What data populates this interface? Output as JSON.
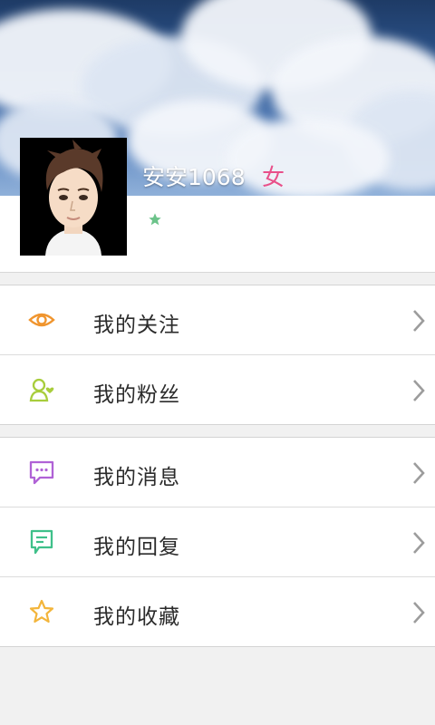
{
  "profile": {
    "username": "安安1068",
    "gender": "女"
  },
  "menu_groups": [
    {
      "items": [
        {
          "label": "我的关注",
          "icon": "eye-icon",
          "color": "#f0952e"
        },
        {
          "label": "我的粉丝",
          "icon": "user-heart-icon",
          "color": "#a8cd3c"
        }
      ]
    },
    {
      "items": [
        {
          "label": "我的消息",
          "icon": "chat-bubble-icon",
          "color": "#b062d6"
        },
        {
          "label": "我的回复",
          "icon": "reply-comment-icon",
          "color": "#3fc08a"
        },
        {
          "label": "我的收藏",
          "icon": "star-icon",
          "color": "#f3b53b"
        }
      ]
    }
  ],
  "colors": {
    "gender": "#e8508a",
    "level_star": "#6cc38a",
    "chevron": "#9c9c9c"
  }
}
